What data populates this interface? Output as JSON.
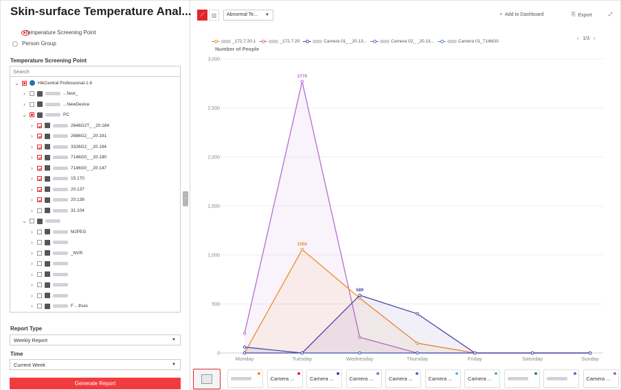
{
  "page": {
    "title": "Skin-surface Temperature Anal..."
  },
  "left": {
    "radio_options": [
      "Temperature Screening Point",
      "Person Group"
    ],
    "selected_radio": 0,
    "tree_heading": "Temperature Screening Point",
    "search_placeholder": "Search",
    "tree": [
      {
        "label": "HikCentral Professional-1.6",
        "level": 0,
        "expanded": true,
        "check": "partial",
        "type": "site"
      },
      {
        "label": "...face_",
        "level": 1,
        "expanded": false,
        "check": "none",
        "type": "device"
      },
      {
        "label": "...NewDevice",
        "level": 1,
        "expanded": false,
        "check": "none",
        "type": "device"
      },
      {
        "label": "PC",
        "level": 1,
        "expanded": true,
        "check": "partial",
        "type": "device"
      },
      {
        "label": "2646G2T_   _20.184",
        "level": 2,
        "expanded": false,
        "check": "checked",
        "type": "device"
      },
      {
        "label": "2686G2_   _20.191",
        "level": 2,
        "expanded": false,
        "check": "checked",
        "type": "device"
      },
      {
        "label": "3326G2_   _20.194",
        "level": 2,
        "expanded": false,
        "check": "checked",
        "type": "device"
      },
      {
        "label": "7146G0_   _20.190",
        "level": 2,
        "expanded": false,
        "check": "checked",
        "type": "device"
      },
      {
        "label": "7146G0_   _20.147",
        "level": 2,
        "expanded": false,
        "check": "checked",
        "type": "device"
      },
      {
        "label": "15.170",
        "level": 2,
        "expanded": false,
        "check": "checked",
        "type": "device"
      },
      {
        "label": "20.137",
        "level": 2,
        "expanded": false,
        "check": "checked",
        "type": "device"
      },
      {
        "label": "20.138",
        "level": 2,
        "expanded": false,
        "check": "checked",
        "type": "device"
      },
      {
        "label": "31.104",
        "level": 2,
        "expanded": false,
        "check": "none",
        "type": "device"
      },
      {
        "label": "",
        "level": 1,
        "expanded": true,
        "check": "none",
        "type": "device"
      },
      {
        "label": "MJPEG",
        "level": 2,
        "expanded": false,
        "check": "none",
        "type": "device"
      },
      {
        "label": "",
        "level": 2,
        "expanded": false,
        "check": "none",
        "type": "device"
      },
      {
        "label": "_NVR",
        "level": 2,
        "expanded": false,
        "check": "none",
        "type": "device"
      },
      {
        "label": "",
        "level": 2,
        "expanded": false,
        "check": "none",
        "type": "device"
      },
      {
        "label": "",
        "level": 2,
        "expanded": false,
        "check": "none",
        "type": "device"
      },
      {
        "label": "",
        "level": 2,
        "expanded": false,
        "check": "none",
        "type": "device"
      },
      {
        "label": "",
        "level": 2,
        "expanded": false,
        "check": "none",
        "type": "device"
      },
      {
        "label": "F   ...thuis",
        "level": 2,
        "expanded": false,
        "check": "none",
        "type": "device"
      }
    ],
    "report_type_label": "Report Type",
    "report_type_value": "Weekly Report",
    "time_label": "Time",
    "time_value": "Current Week",
    "generate_label": "Generate Report"
  },
  "toolbar": {
    "metric_value": "Abnormal Te...",
    "add_dashboard": "Add to Dashboard",
    "export": "Export"
  },
  "legend": {
    "items": [
      {
        "label": "_172.7.20.1",
        "color": "#f08a24"
      },
      {
        "label": "_172.7.20",
        "color": "#e05a9a"
      },
      {
        "label": "Camera 01_   _20.13...",
        "color": "#4a3fa8"
      },
      {
        "label": "Camera 02_   _20.13...",
        "color": "#6a5fc8"
      },
      {
        "label": "Camera 01_7146G0",
        "color": "#5a7fd6"
      }
    ],
    "page": "1/3"
  },
  "chart_data": {
    "type": "line",
    "ylabel": "Number of People",
    "categories": [
      "Monday",
      "Tuesday",
      "Wednesday",
      "Thursday",
      "Friday",
      "Saturday",
      "Sunday"
    ],
    "ylim": [
      0,
      3000
    ],
    "yticks": [
      0,
      500,
      1000,
      1500,
      2000,
      2500,
      3000
    ],
    "ytick_labels": [
      "0",
      "500",
      "1,000",
      "1,500",
      "2,000",
      "2,500",
      "3,000"
    ],
    "series": [
      {
        "values": [
          200,
          2770,
          160,
          0,
          0,
          0,
          0
        ],
        "color": "#b56bd0",
        "labels": {
          "1": "2770"
        }
      },
      {
        "values": [
          0,
          1056,
          560,
          100,
          0,
          0,
          0
        ],
        "color": "#f08a24",
        "labels": {
          "1": "1056"
        }
      },
      {
        "values": [
          0,
          0,
          589,
          400,
          0,
          0,
          0
        ],
        "color": "#4a3fa8",
        "labels": {
          "2": "589"
        }
      },
      {
        "values": [
          60,
          0,
          0,
          0,
          0,
          0,
          0
        ],
        "color": "#3a4fb0",
        "labels": {}
      }
    ]
  },
  "thumbnails": [
    {
      "label": "",
      "dot": "#f08a24"
    },
    {
      "label": "Camera ...",
      "dot": "#e0262b"
    },
    {
      "label": "Camera ...",
      "dot": "#4a3fa8"
    },
    {
      "label": "Camera ...",
      "dot": "#8a6fd8"
    },
    {
      "label": "Camera ...",
      "dot": "#3a6fd0"
    },
    {
      "label": "Camera ...",
      "dot": "#4ac0e0"
    },
    {
      "label": "Camera ...",
      "dot": "#3ac090"
    },
    {
      "label": "",
      "dot": "#2a8a50"
    },
    {
      "label": "",
      "dot": "#8a4fd0"
    },
    {
      "label": "Camera ...",
      "dot": "#c050c0"
    }
  ]
}
